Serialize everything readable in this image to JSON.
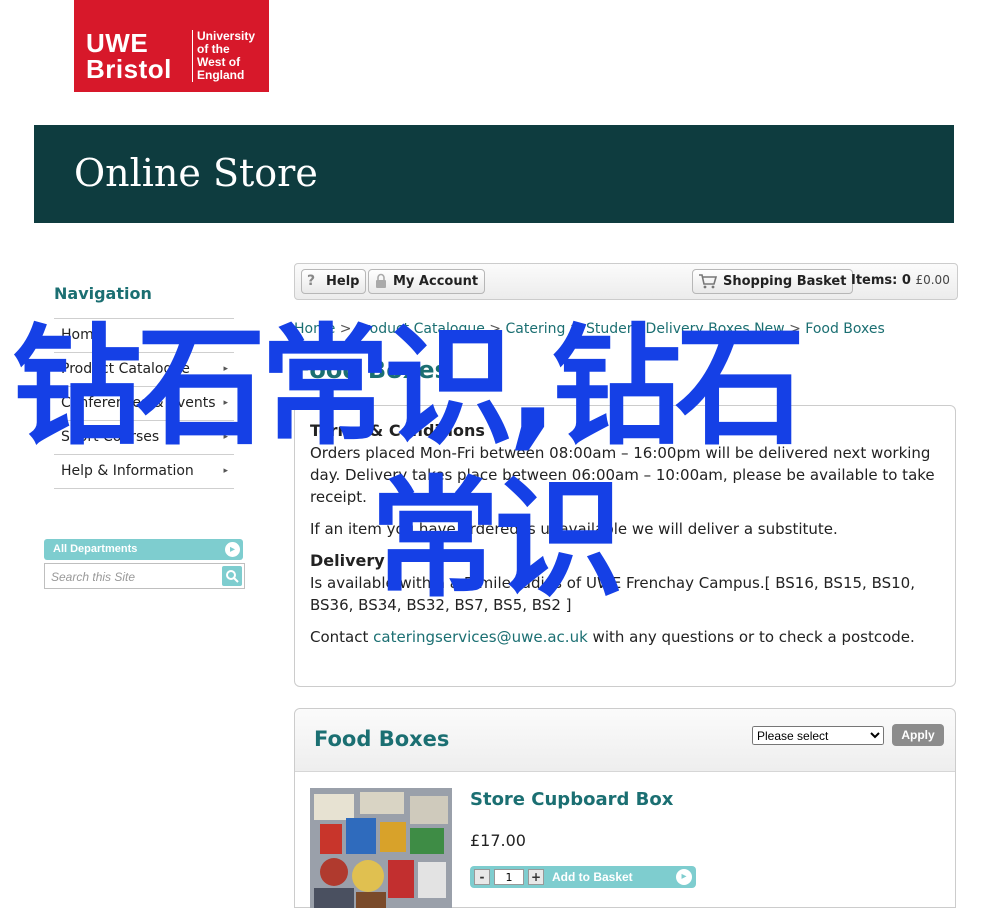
{
  "logo": {
    "brand_line1": "UWE",
    "brand_line2": "Bristol",
    "uni_line1": "University",
    "uni_line2": "of the",
    "uni_line3": "West of",
    "uni_line4": "England"
  },
  "banner": {
    "title": "Online Store"
  },
  "navigation": {
    "title": "Navigation",
    "items": [
      {
        "label": "Home"
      },
      {
        "label": "Product Catalogue"
      },
      {
        "label": "Conferences & Events"
      },
      {
        "label": "Short Courses"
      },
      {
        "label": "Help & Information"
      }
    ]
  },
  "search": {
    "department_label": "All Departments",
    "placeholder": "Search this Site"
  },
  "toolbar": {
    "help_label": "Help",
    "account_label": "My Account",
    "basket_label": "Shopping Basket",
    "items_label": "Items:",
    "items_count": "0",
    "items_total": "£0.00"
  },
  "breadcrumb": [
    "Home",
    "Product Catalogue",
    "Catering",
    "Student Delivery Boxes New",
    "Food Boxes"
  ],
  "page": {
    "title": "Food Boxes"
  },
  "info": {
    "terms_heading": "Terms & Conditions",
    "terms_text": "Orders placed Mon-Fri between 08:00am – 16:00pm will be delivered next working day. Delivery takes place between 06:00am – 10:00am, please be available to take receipt.",
    "substitute_text": "If an item you have ordered is unavailable we will deliver a substitute.",
    "delivery_heading": "Delivery",
    "delivery_text": "Is available within a 5-mile radius of UWE Frenchay Campus.[ BS16, BS15, BS10, BS36, BS34, BS32, BS7, BS5, BS2 ]",
    "contact_prefix": "Contact ",
    "contact_email": "cateringservices@uwe.ac.uk",
    "contact_suffix": " with any questions or to check a postcode."
  },
  "food_boxes": {
    "title": "Food Boxes",
    "select_value": "Please select",
    "apply_label": "Apply"
  },
  "product": {
    "name": "Store Cupboard Box",
    "price": "£17.00",
    "quantity": "1",
    "minus": "-",
    "plus": "+",
    "add_label": "Add to Basket"
  },
  "overlay": {
    "line1": "钻石常识,钻石",
    "line2": "常识"
  },
  "colors": {
    "brand_red": "#d7182a",
    "banner": "#0e3c3f",
    "accent_teal": "#1b6f72",
    "button_teal": "#7ecdcf",
    "overlay_blue": "#1540e6"
  }
}
